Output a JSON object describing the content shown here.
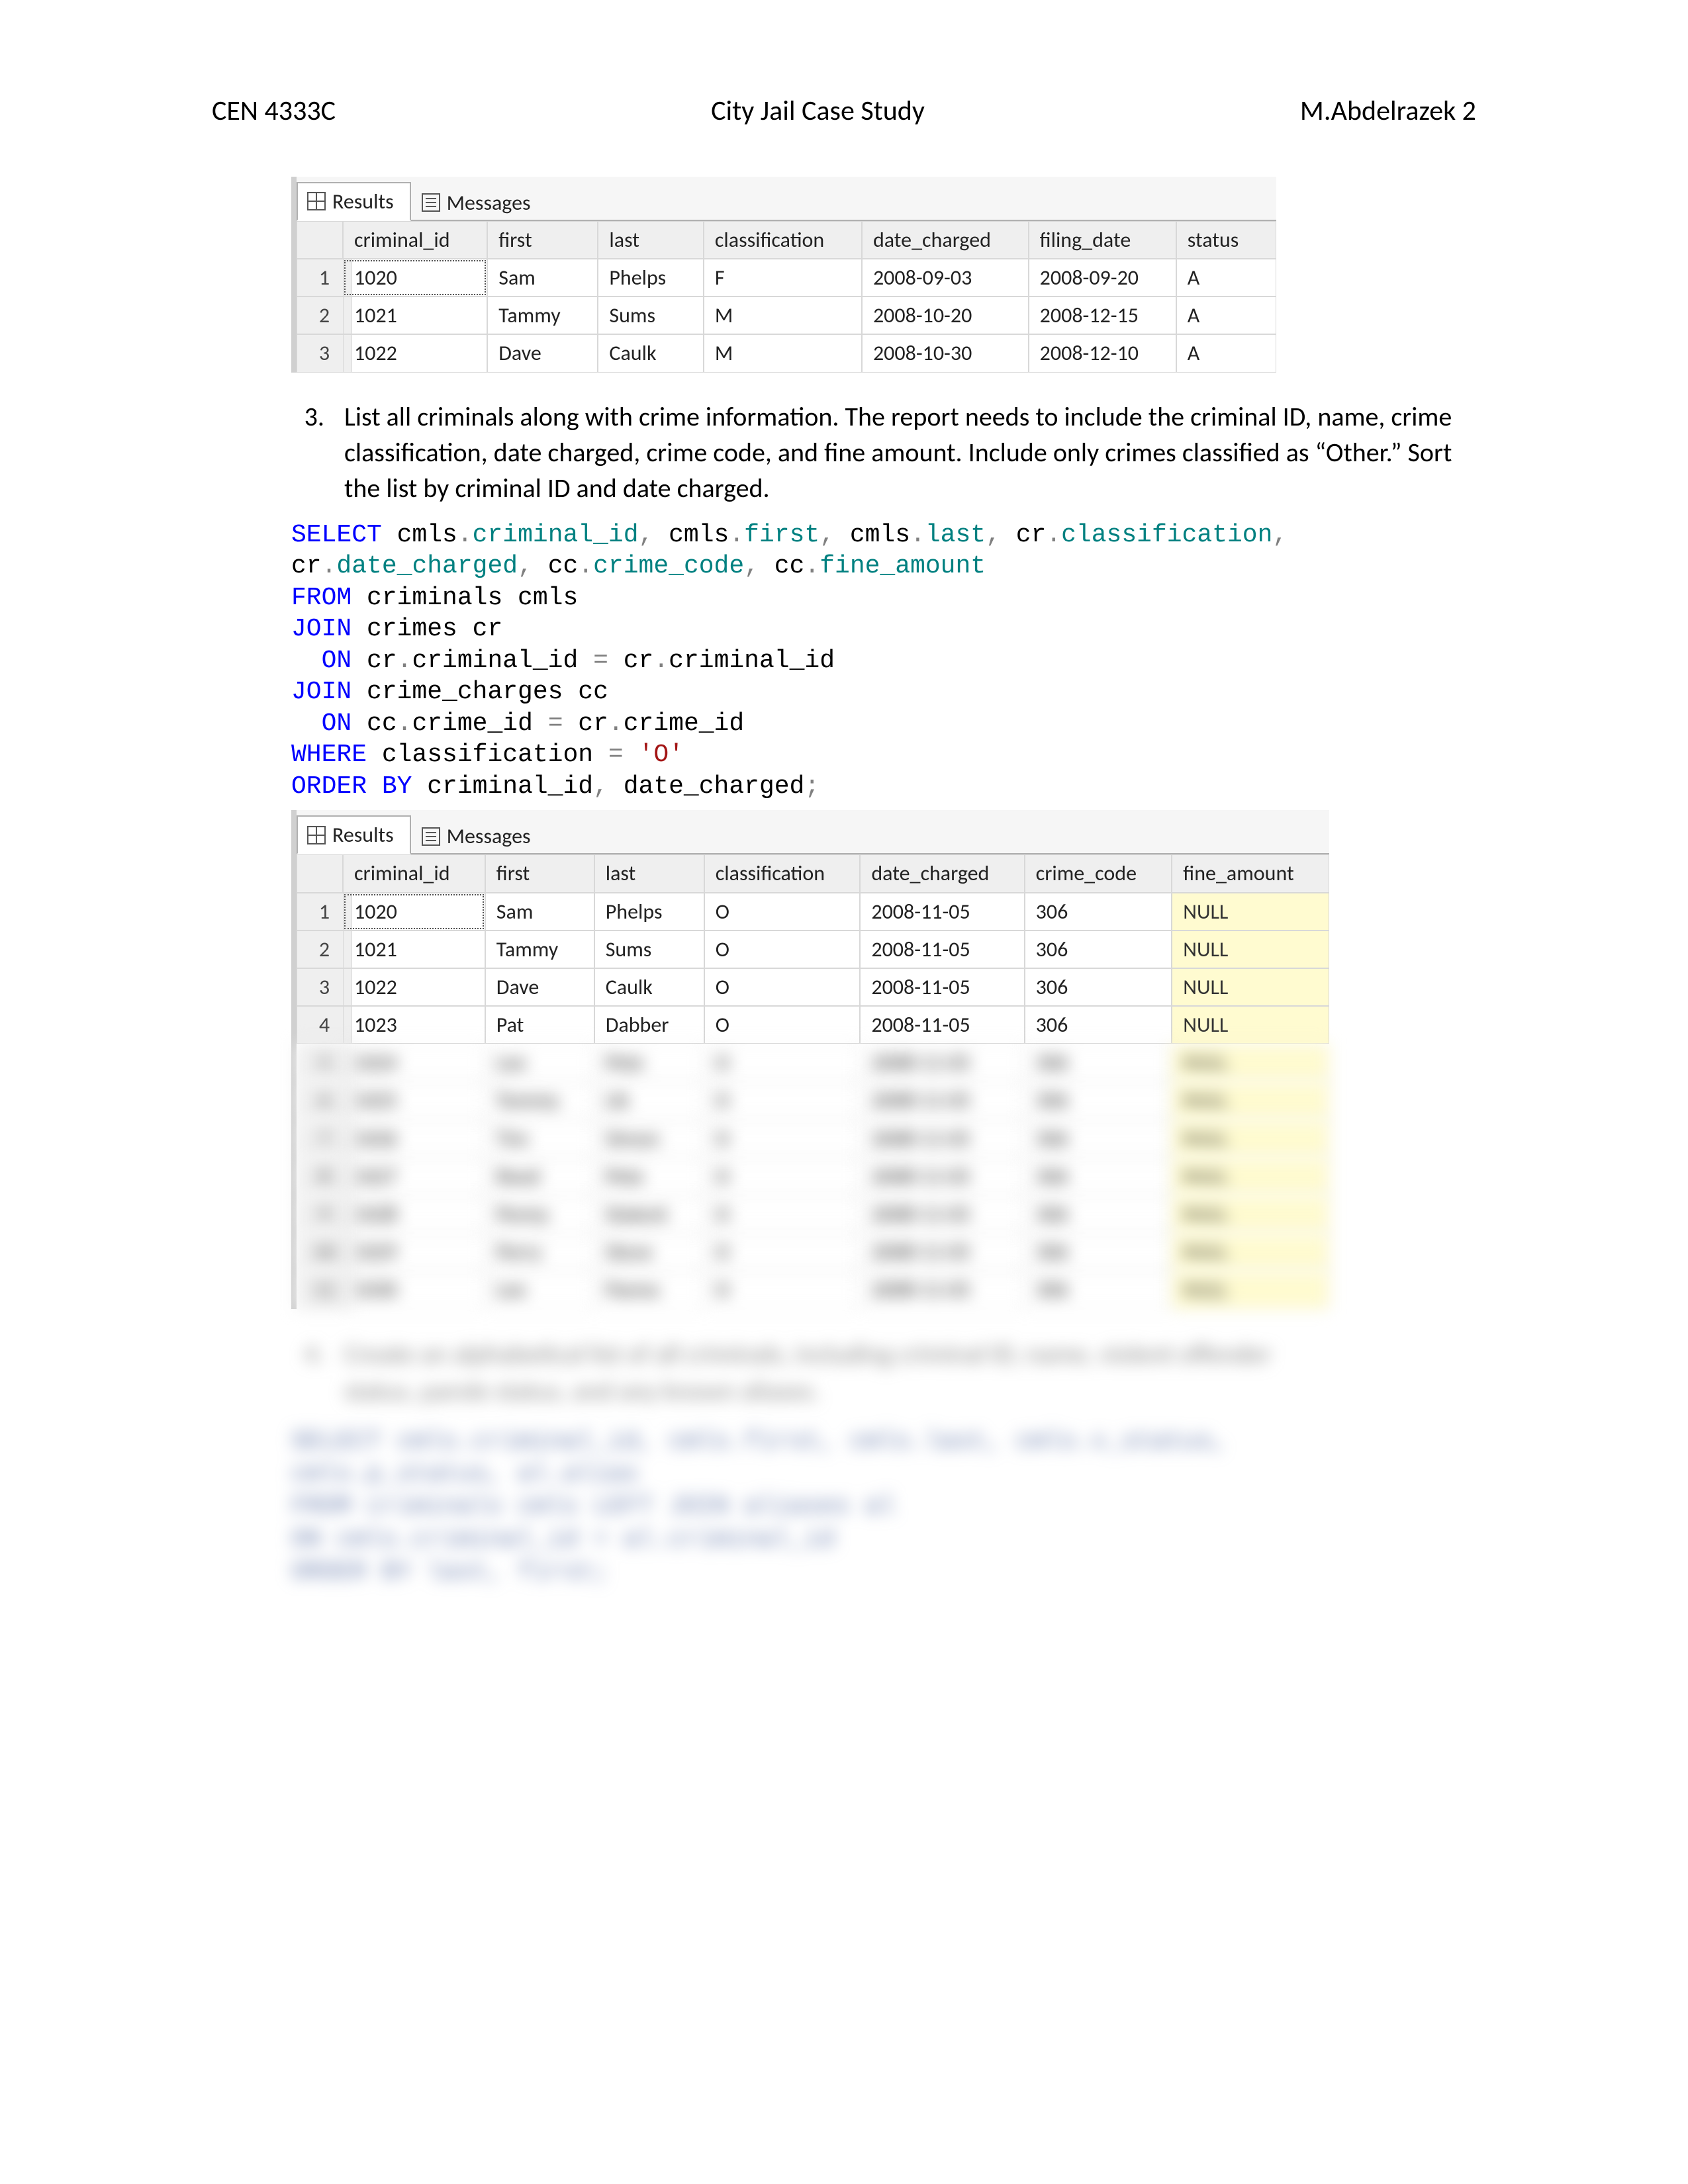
{
  "header": {
    "course": "CEN 4333C",
    "title": "City Jail Case Study",
    "author": "M.Abdelrazek 2"
  },
  "panel1": {
    "tabs": {
      "results": "Results",
      "messages": "Messages"
    },
    "columns": [
      "criminal_id",
      "first",
      "last",
      "classification",
      "date_charged",
      "filing_date",
      "status"
    ],
    "rownums": [
      "1",
      "2",
      "3"
    ],
    "rows": [
      [
        "1020",
        "Sam",
        "Phelps",
        "F",
        "2008-09-03",
        "2008-09-20",
        "A"
      ],
      [
        "1021",
        "Tammy",
        "Sums",
        "M",
        "2008-10-20",
        "2008-12-15",
        "A"
      ],
      [
        "1022",
        "Dave",
        "Caulk",
        "M",
        "2008-10-30",
        "2008-12-10",
        "A"
      ]
    ]
  },
  "q3": {
    "number": "3.",
    "text": "List all criminals along with crime information. The report needs to include the criminal ID, name, crime classification, date charged, crime code, and fine amount. Include only crimes classified as “Other.” Sort the list by criminal ID and date charged."
  },
  "sql3": {
    "l1a": "SELECT",
    "l1b": " cmls",
    "l1c": ".",
    "l1d": "criminal_id",
    "l1e": ",",
    "l1f": " cmls",
    "l1g": ".",
    "l1h": "first",
    "l1i": ",",
    "l1j": " cmls",
    "l1k": ".",
    "l1l": "last",
    "l1m": ",",
    "l1n": " cr",
    "l1o": ".",
    "l1p": "classification",
    "l1q": ",",
    "l2a": "cr",
    "l2b": ".",
    "l2c": "date_charged",
    "l2d": ",",
    "l2e": " cc",
    "l2f": ".",
    "l2g": "crime_code",
    "l2h": ",",
    "l2i": " cc",
    "l2j": ".",
    "l2k": "fine_amount",
    "l3a": "FROM",
    "l3b": " criminals cmls",
    "l4a": "JOIN",
    "l4b": " crimes cr",
    "l5a": "  ",
    "l5b": "ON",
    "l5c": " cr",
    "l5d": ".",
    "l5e": "criminal_id ",
    "l5f": "=",
    "l5g": " cr",
    "l5h": ".",
    "l5i": "criminal_id",
    "l6a": "JOIN",
    "l6b": " crime_charges cc",
    "l7a": "  ",
    "l7b": "ON",
    "l7c": " cc",
    "l7d": ".",
    "l7e": "crime_id ",
    "l7f": "=",
    "l7g": " cr",
    "l7h": ".",
    "l7i": "crime_id",
    "l8a": "WHERE",
    "l8b": " classification ",
    "l8c": "=",
    "l8d": " ",
    "l8e": "'O'",
    "l9a": "ORDER BY",
    "l9b": " criminal_id",
    "l9c": ",",
    "l9d": " date_charged",
    "l9e": ";"
  },
  "panel2": {
    "tabs": {
      "results": "Results",
      "messages": "Messages"
    },
    "columns": [
      "criminal_id",
      "first",
      "last",
      "classification",
      "date_charged",
      "crime_code",
      "fine_amount"
    ],
    "rownums": [
      "1",
      "2",
      "3",
      "4"
    ],
    "rows": [
      [
        "1020",
        "Sam",
        "Phelps",
        "O",
        "2008-11-05",
        "306",
        "NULL"
      ],
      [
        "1021",
        "Tammy",
        "Sums",
        "O",
        "2008-11-05",
        "306",
        "NULL"
      ],
      [
        "1022",
        "Dave",
        "Caulk",
        "O",
        "2008-11-05",
        "306",
        "NULL"
      ],
      [
        "1023",
        "Pat",
        "Dabber",
        "O",
        "2008-11-05",
        "306",
        "NULL"
      ]
    ],
    "blurred_rownums": [
      "5",
      "6",
      "7",
      "8",
      "9",
      "10",
      "11"
    ],
    "blurred_rows": [
      [
        "1024",
        "Lee",
        "Pete",
        "O",
        "2008-11-05",
        "306",
        "NULL"
      ],
      [
        "1025",
        "Tommy",
        "Lik",
        "O",
        "2008-11-05",
        "306",
        "NULL"
      ],
      [
        "1026",
        "Tim",
        "Simon",
        "O",
        "2008-11-05",
        "306",
        "NULL"
      ],
      [
        "1027",
        "Reed",
        "Pete",
        "O",
        "2008-11-05",
        "306",
        "NULL"
      ],
      [
        "1028",
        "Penny",
        "Statent",
        "O",
        "2008-11-05",
        "306",
        "NULL"
      ],
      [
        "1029",
        "Perry",
        "Steve",
        "O",
        "2008-11-05",
        "306",
        "NULL"
      ],
      [
        "1030",
        "Lee",
        "Panno",
        "O",
        "2008-11-05",
        "306",
        "NULL"
      ]
    ]
  },
  "q4": {
    "number": "4.",
    "text_line1": "Create an alphabetical list of all criminals, including criminal ID, name, violent offender",
    "text_line2": "status, parole status, and any known aliases."
  },
  "sql4_lines": [
    "SELECT cmls.criminal_id, cmls.first, cmls.last, cmls.v_status,",
    "cmls.p_status, al.alias",
    "FROM criminals cmls LEFT JOIN aliases al",
    "  ON cmls.criminal_id = al.criminal_id",
    "ORDER BY last, first;"
  ]
}
